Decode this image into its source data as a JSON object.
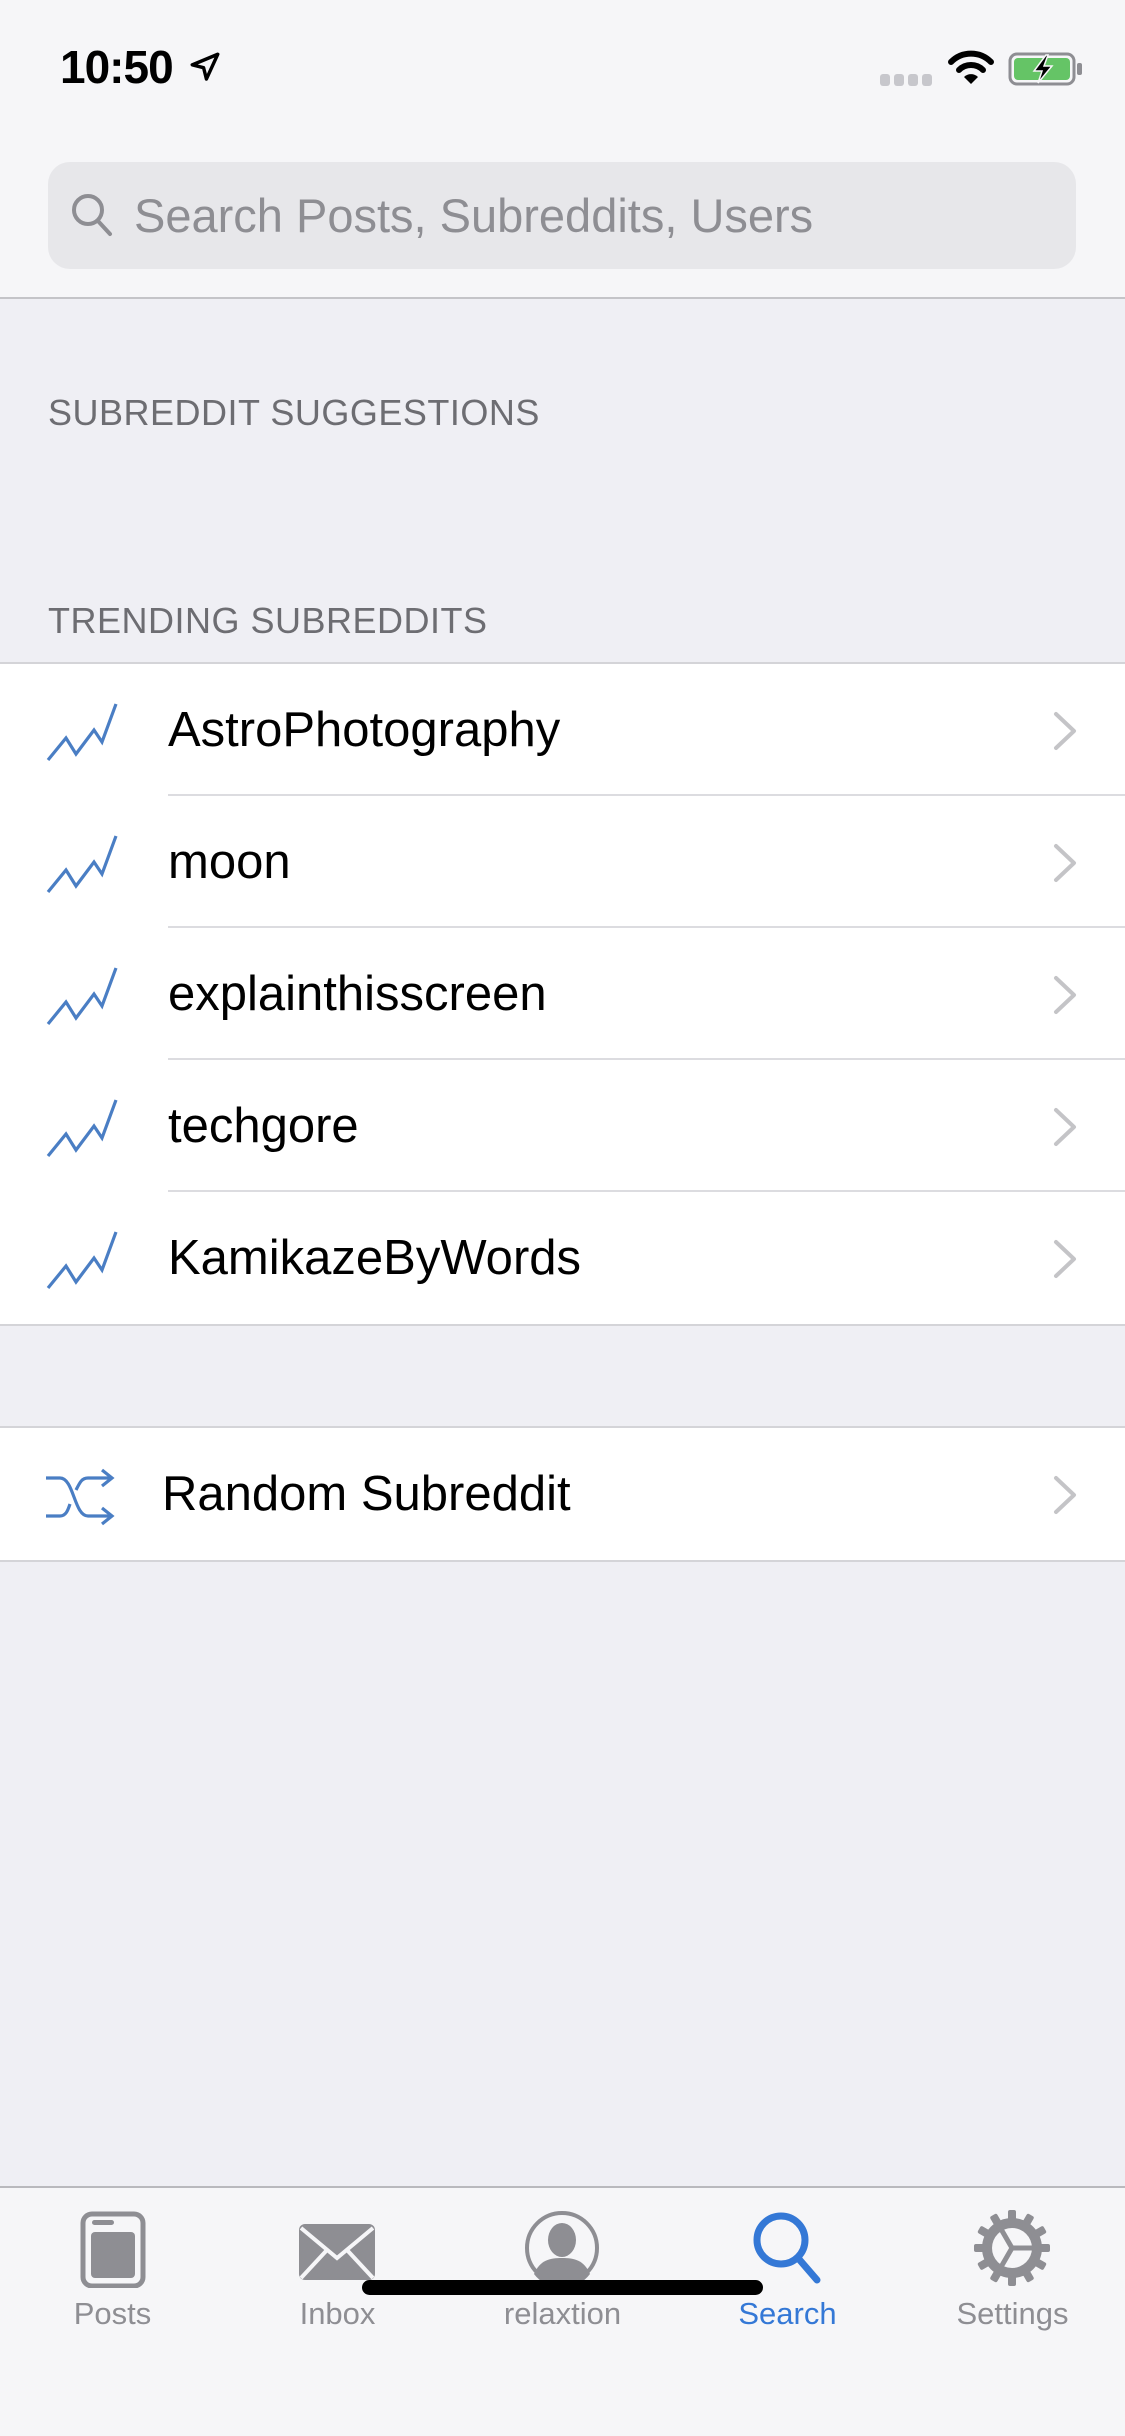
{
  "status_bar": {
    "time": "10:50",
    "location_icon": "location-arrow-icon",
    "signal_icon": "cellular-signal-icon",
    "wifi_icon": "wifi-icon",
    "battery_icon": "battery-charging-icon",
    "battery_color": "#65c466"
  },
  "search": {
    "placeholder": "Search Posts, Subreddits, Users",
    "value": "",
    "icon": "search-icon"
  },
  "sections": {
    "suggestions_header": "SUBREDDIT SUGGESTIONS",
    "trending_header": "TRENDING SUBREDDITS"
  },
  "trending": [
    {
      "name": "AstroPhotography",
      "icon": "trending-icon"
    },
    {
      "name": "moon",
      "icon": "trending-icon"
    },
    {
      "name": "explainthisscreen",
      "icon": "trending-icon"
    },
    {
      "name": "techgore",
      "icon": "trending-icon"
    },
    {
      "name": "KamikazeByWords",
      "icon": "trending-icon"
    }
  ],
  "random": {
    "label": "Random Subreddit",
    "icon": "shuffle-icon"
  },
  "tabbar": {
    "active": "Search",
    "accent_color": "#3478d6",
    "inactive_color": "#8e8e93",
    "tabs": [
      {
        "label": "Posts",
        "icon": "posts-icon"
      },
      {
        "label": "Inbox",
        "icon": "envelope-icon"
      },
      {
        "label": "relaxtion",
        "icon": "profile-icon"
      },
      {
        "label": "Search",
        "icon": "search-icon"
      },
      {
        "label": "Settings",
        "icon": "gear-icon"
      }
    ]
  },
  "colors": {
    "accent": "#3478d6",
    "icon_blue": "#4a7ec4",
    "background": "#efeff4",
    "header_text": "#6d6d72"
  }
}
